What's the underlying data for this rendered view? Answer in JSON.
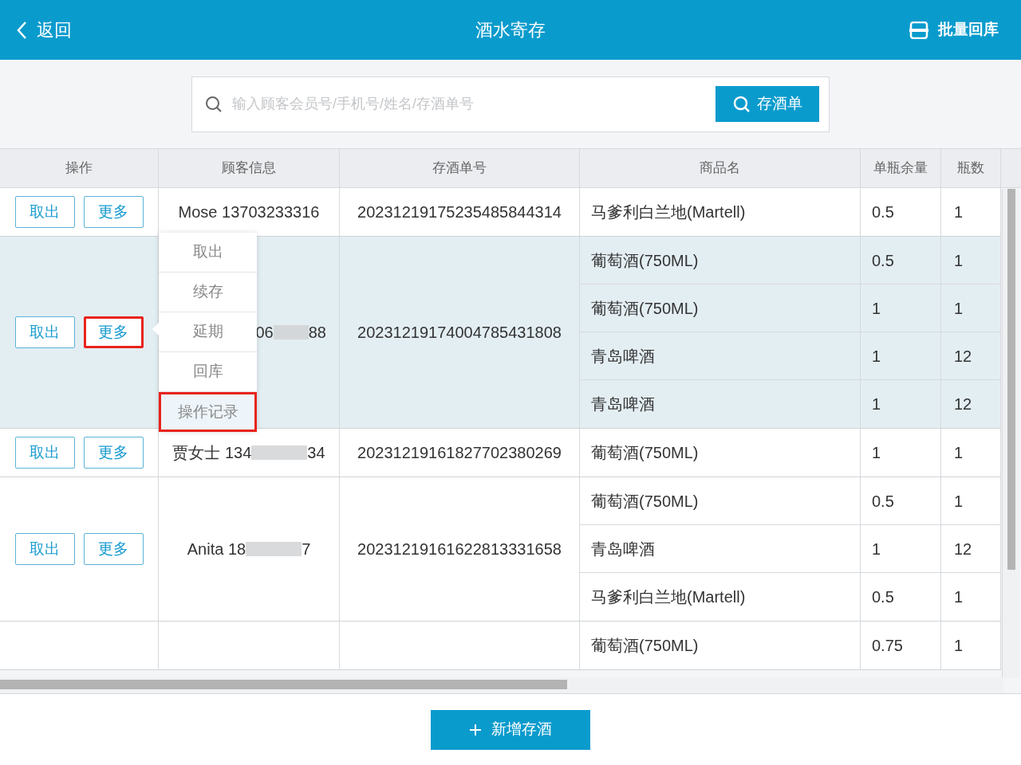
{
  "header": {
    "back": "返回",
    "title": "酒水寄存",
    "batch_button": "批量回库"
  },
  "search": {
    "placeholder": "输入顾客会员号/手机号/姓名/存酒单号",
    "button": "存酒单"
  },
  "table": {
    "columns": [
      "操作",
      "顾客信息",
      "存酒单号",
      "商品名",
      "单瓶余量",
      "瓶数"
    ],
    "groups": [
      {
        "selected": false,
        "actions": [
          "取出",
          "更多"
        ],
        "more_highlighted": false,
        "customer": {
          "prefix": "Mose 13703233316",
          "masked": false
        },
        "order": "20231219175235485844314",
        "items": [
          {
            "name": "马爹利白兰地(Martell)",
            "remaining": "0.5",
            "bottles": "1"
          }
        ]
      },
      {
        "selected": true,
        "actions": [
          "取出",
          "更多"
        ],
        "more_highlighted": true,
        "customer": {
          "prefix": "06",
          "suffix": "88",
          "masked": true
        },
        "order": "20231219174004785431808",
        "items": [
          {
            "name": "葡萄酒(750ML)",
            "remaining": "0.5",
            "bottles": "1"
          },
          {
            "name": "葡萄酒(750ML)",
            "remaining": "1",
            "bottles": "1"
          },
          {
            "name": "青岛啤酒",
            "remaining": "1",
            "bottles": "12"
          },
          {
            "name": "青岛啤酒",
            "remaining": "1",
            "bottles": "12"
          }
        ],
        "menu": [
          {
            "label": "取出",
            "highlighted": false
          },
          {
            "label": "续存",
            "highlighted": false
          },
          {
            "label": "延期",
            "highlighted": false
          },
          {
            "label": "回库",
            "highlighted": false
          },
          {
            "label": "操作记录",
            "highlighted": true
          }
        ]
      },
      {
        "selected": false,
        "actions": [
          "取出",
          "更多"
        ],
        "more_highlighted": false,
        "customer": {
          "prefix": "贾女士 134",
          "suffix": "34",
          "masked": true
        },
        "order": "20231219161827702380269",
        "items": [
          {
            "name": "葡萄酒(750ML)",
            "remaining": "1",
            "bottles": "1"
          }
        ]
      },
      {
        "selected": false,
        "actions": [
          "取出",
          "更多"
        ],
        "more_highlighted": false,
        "customer": {
          "prefix": "Anita 18",
          "suffix": "7",
          "masked": true
        },
        "order": "20231219161622813331658",
        "items": [
          {
            "name": "葡萄酒(750ML)",
            "remaining": "0.5",
            "bottles": "1"
          },
          {
            "name": "青岛啤酒",
            "remaining": "1",
            "bottles": "12"
          },
          {
            "name": "马爹利白兰地(Martell)",
            "remaining": "0.5",
            "bottles": "1"
          }
        ]
      },
      {
        "selected": false,
        "items": [
          {
            "name": "葡萄酒(750ML)",
            "remaining": "0.75",
            "bottles": "1"
          }
        ]
      }
    ]
  },
  "footer": {
    "add_button": "新增存酒"
  }
}
